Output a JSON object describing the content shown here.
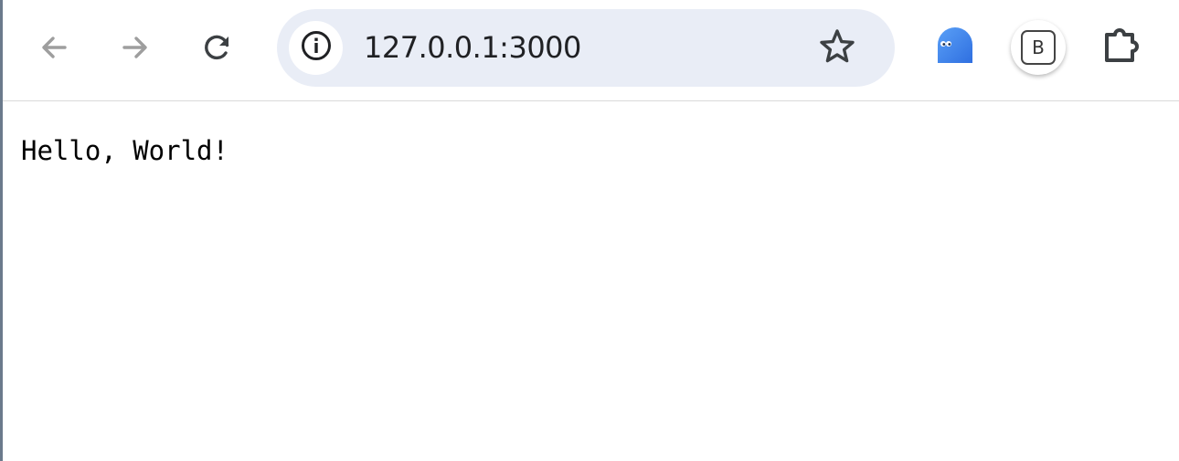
{
  "toolbar": {
    "back_icon": "arrow-left-icon",
    "forward_icon": "arrow-right-icon",
    "reload_icon": "reload-icon",
    "omnibox": {
      "site_info_icon": "info-icon",
      "url": "127.0.0.1:3000",
      "bookmark_icon": "star-outline-icon"
    },
    "extensions": {
      "ghost_extension_icon": "ghost-icon",
      "b_extension_label": "B",
      "extensions_menu_icon": "puzzle-icon"
    }
  },
  "page": {
    "body_text": "Hello, World!"
  },
  "colors": {
    "omnibox_bg": "#e9edf6",
    "disabled_icon": "#9e9e9e",
    "active_icon": "#3c4043",
    "ghost_blue": "#4a8df0"
  }
}
